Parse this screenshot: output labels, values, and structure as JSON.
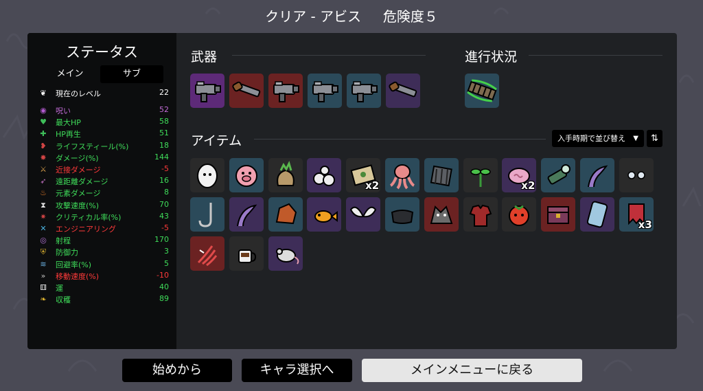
{
  "header": {
    "title": "クリア - アビス     危険度５"
  },
  "stats": {
    "title": "ステータス",
    "tabs": {
      "main": "メイン",
      "sub": "サブ"
    },
    "level": {
      "label": "現在のレベル",
      "value": "22"
    },
    "rows": [
      {
        "icon": "curse-icon",
        "label": "呪い",
        "value": "52",
        "color": "#c26bd6"
      },
      {
        "icon": "heart-icon",
        "label": "最大HP",
        "value": "58",
        "color": "#3fdc5a"
      },
      {
        "icon": "regen-icon",
        "label": "HP再生",
        "value": "51",
        "color": "#3fdc5a"
      },
      {
        "icon": "lifesteal-icon",
        "label": "ライフスティール(%)",
        "value": "18",
        "color": "#3fdc5a"
      },
      {
        "icon": "damage-icon",
        "label": "ダメージ(%)",
        "value": "144",
        "color": "#3fdc5a"
      },
      {
        "icon": "melee-icon",
        "label": "近接ダメージ",
        "value": "-5",
        "color": "#ff3a3a"
      },
      {
        "icon": "ranged-icon",
        "label": "遠距離ダメージ",
        "value": "16",
        "color": "#3fdc5a"
      },
      {
        "icon": "elemental-icon",
        "label": "元素ダメージ",
        "value": "8",
        "color": "#3fdc5a"
      },
      {
        "icon": "attack-speed-icon",
        "label": "攻撃速度(%)",
        "value": "70",
        "color": "#3fdc5a"
      },
      {
        "icon": "crit-icon",
        "label": "クリティカル率(%)",
        "value": "43",
        "color": "#3fdc5a"
      },
      {
        "icon": "engineering-icon",
        "label": "エンジニアリング",
        "value": "-5",
        "color": "#ff3a3a"
      },
      {
        "icon": "range-icon",
        "label": "射程",
        "value": "170",
        "color": "#3fdc5a"
      },
      {
        "icon": "armor-icon",
        "label": "防御力",
        "value": "3",
        "color": "#3fdc5a"
      },
      {
        "icon": "dodge-icon",
        "label": "回避率(%)",
        "value": "5",
        "color": "#3fdc5a"
      },
      {
        "icon": "speed-icon",
        "label": "移動速度(%)",
        "value": "-10",
        "color": "#ff3a3a"
      },
      {
        "icon": "luck-icon",
        "label": "運",
        "value": "40",
        "color": "#3fdc5a"
      },
      {
        "icon": "harvest-icon",
        "label": "収穫",
        "value": "89",
        "color": "#3fdc5a"
      }
    ]
  },
  "weapons": {
    "title": "武器",
    "items": [
      {
        "icon": "smg-icon",
        "bg": "#5d2a78"
      },
      {
        "icon": "revolver-icon",
        "bg": "#6b2222"
      },
      {
        "icon": "smg-icon",
        "bg": "#6b2222"
      },
      {
        "icon": "smg-icon",
        "bg": "#2b4a5a"
      },
      {
        "icon": "smg-icon",
        "bg": "#2b4a5a"
      },
      {
        "icon": "revolver-icon",
        "bg": "#3e2d58"
      }
    ]
  },
  "progress": {
    "title": "進行状況",
    "items": [
      {
        "icon": "bridge-icon",
        "bg": "#2b4a5a"
      }
    ]
  },
  "items": {
    "title": "アイテム",
    "sort_label": "入手時期で並び替え",
    "list": [
      {
        "icon": "egg-icon",
        "bg": "#2a2a2a",
        "count": ""
      },
      {
        "icon": "pig-icon",
        "bg": "#2b4a5a",
        "count": ""
      },
      {
        "icon": "sack-icon",
        "bg": "#2a2a2a",
        "count": ""
      },
      {
        "icon": "skulls-icon",
        "bg": "#3e2d58",
        "count": ""
      },
      {
        "icon": "scroll-icon",
        "bg": "#2a2a2a",
        "count": "x2"
      },
      {
        "icon": "octopus-icon",
        "bg": "#2b4a5a",
        "count": ""
      },
      {
        "icon": "cage-icon",
        "bg": "#2b4a5a",
        "count": ""
      },
      {
        "icon": "sprout-icon",
        "bg": "#2a2a2a",
        "count": ""
      },
      {
        "icon": "brain-icon",
        "bg": "#3e2d58",
        "count": "x2"
      },
      {
        "icon": "flashlight-icon",
        "bg": "#2b4a5a",
        "count": ""
      },
      {
        "icon": "tentacle-icon",
        "bg": "#2b4a5a",
        "count": ""
      },
      {
        "icon": "eyes-icon",
        "bg": "#2a2a2a",
        "count": ""
      },
      {
        "icon": "hook-icon",
        "bg": "#2b4a5a",
        "count": ""
      },
      {
        "icon": "tentacle-icon",
        "bg": "#3e2d58",
        "count": ""
      },
      {
        "icon": "rock-icon",
        "bg": "#2b4a5a",
        "count": ""
      },
      {
        "icon": "fish-icon",
        "bg": "#3e2d58",
        "count": ""
      },
      {
        "icon": "wings-icon",
        "bg": "#3e2d58",
        "count": ""
      },
      {
        "icon": "cloth-icon",
        "bg": "#2b4a5a",
        "count": ""
      },
      {
        "icon": "wolf-icon",
        "bg": "#6b2222",
        "count": ""
      },
      {
        "icon": "shirt-icon",
        "bg": "#2a2a2a",
        "count": ""
      },
      {
        "icon": "tomato-icon",
        "bg": "#2a2a2a",
        "count": ""
      },
      {
        "icon": "chest-icon",
        "bg": "#6b2222",
        "count": ""
      },
      {
        "icon": "mirror-icon",
        "bg": "#3e2d58",
        "count": ""
      },
      {
        "icon": "banner-icon",
        "bg": "#2b4a5a",
        "count": "x3"
      },
      {
        "icon": "claw-icon",
        "bg": "#6b2222",
        "count": ""
      },
      {
        "icon": "coffee-icon",
        "bg": "#2a2a2a",
        "count": ""
      },
      {
        "icon": "rat-icon",
        "bg": "#3e2d58",
        "count": ""
      }
    ]
  },
  "buttons": {
    "restart": "始めから",
    "char_select": "キャラ選択へ",
    "main_menu": "メインメニューに戻る"
  }
}
